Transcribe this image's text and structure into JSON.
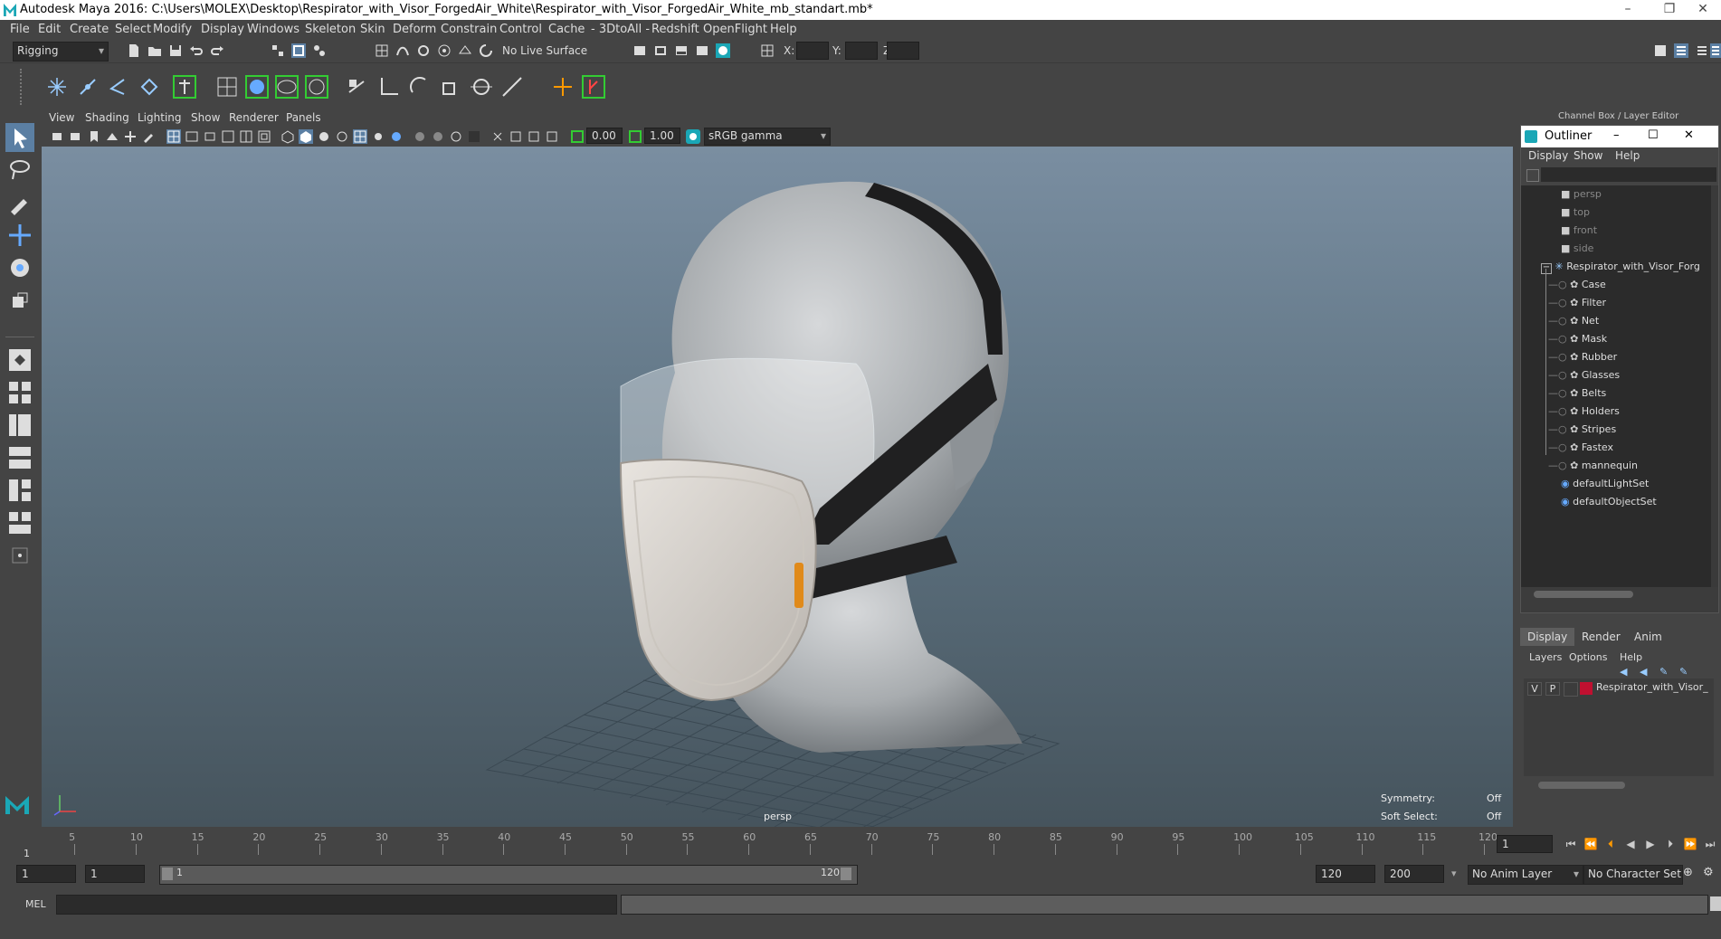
{
  "titlebar": {
    "title": "Autodesk Maya 2016: C:\\Users\\MOLEX\\Desktop\\Respirator_with_Visor_ForgedAir_White\\Respirator_with_Visor_ForgedAir_White_mb_standart.mb*",
    "minimize": "–",
    "restore": "❐",
    "close": "✕"
  },
  "menubar": {
    "items": [
      "File",
      "Edit",
      "Create",
      "Select",
      "Modify",
      "Display",
      "Windows",
      "Skeleton",
      "Skin",
      "Deform",
      "Constrain",
      "Control",
      "Cache",
      "- 3DtoAll -",
      "Redshift",
      "OpenFlight",
      "Help"
    ]
  },
  "statusline": {
    "mode": "Rigging",
    "live_surface": "No Live Surface",
    "x_label": "X:",
    "y_label": "Y:",
    "z_label": "Z:"
  },
  "viewport": {
    "menu": [
      "View",
      "Shading",
      "Lighting",
      "Show",
      "Renderer",
      "Panels"
    ],
    "exposure": "0.00",
    "gamma": "1.00",
    "color_space": "sRGB gamma",
    "camera_label": "persp",
    "symmetry_label": "Symmetry:",
    "symmetry_value": "Off",
    "soft_select_label": "Soft Select:",
    "soft_select_value": "Off"
  },
  "channel_box": {
    "title": "Channel Box / Layer Editor"
  },
  "outliner": {
    "title": "Outliner",
    "menu": [
      "Display",
      "Show",
      "Help"
    ],
    "cameras": [
      "persp",
      "top",
      "front",
      "side"
    ],
    "group": "Respirator_with_Visor_Forg",
    "children": [
      "Case",
      "Filter",
      "Net",
      "Mask",
      "Rubber",
      "Glasses",
      "Belts",
      "Holders",
      "Stripes",
      "Fastex",
      "mannequin"
    ],
    "sets": [
      "defaultLightSet",
      "defaultObjectSet"
    ]
  },
  "layer_editor": {
    "tabs": [
      "Display",
      "Render",
      "Anim"
    ],
    "menu": [
      "Layers",
      "Options",
      "Help"
    ],
    "layer_v": "V",
    "layer_p": "P",
    "layer_name": "Respirator_with_Visor_",
    "layer_color": "#c01030"
  },
  "timeline": {
    "ticks": [
      "5",
      "10",
      "15",
      "20",
      "25",
      "30",
      "35",
      "40",
      "45",
      "50",
      "55",
      "60",
      "65",
      "70",
      "75",
      "80",
      "85",
      "90",
      "95",
      "100",
      "105",
      "110",
      "115",
      "120"
    ],
    "start_marker": "1",
    "current_frame": "1"
  },
  "rangebar": {
    "start": "1",
    "playback_start": "1",
    "slider_start": "1",
    "slider_end": "120",
    "playback_end": "120",
    "end": "200",
    "anim_layer": "No Anim Layer",
    "character_set": "No Character Set"
  },
  "cmdline": {
    "label": "MEL"
  }
}
